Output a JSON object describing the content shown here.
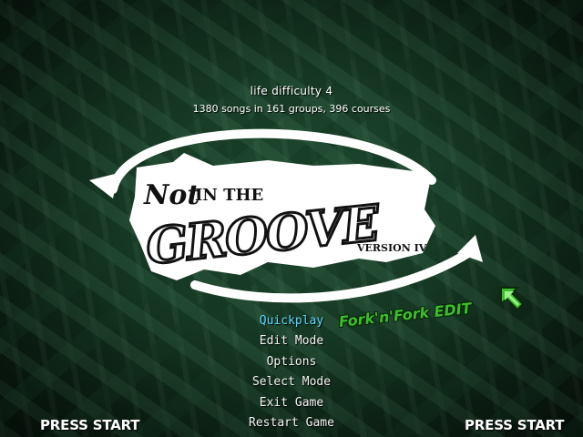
{
  "header": {
    "difficulty": "life difficulty 4",
    "song_stats": "1380 songs in 161 groups, 396 courses"
  },
  "logo": {
    "word_not": "Not",
    "word_in_the": "IN THE",
    "word_groove": "GROOVE",
    "version": "VERSION IV"
  },
  "menu": {
    "items": [
      {
        "label": "Quickplay",
        "selected": true
      },
      {
        "label": "Edit Mode",
        "selected": false
      },
      {
        "label": "Options",
        "selected": false
      },
      {
        "label": "Select Mode",
        "selected": false
      },
      {
        "label": "Exit Game",
        "selected": false
      },
      {
        "label": "Restart Game",
        "selected": false
      }
    ]
  },
  "badge": {
    "text": "Fork'n'Fork EDIT",
    "icon": "green-arrow-icon"
  },
  "players": {
    "p1_prompt": "PRESS START",
    "p2_prompt": "PRESS START"
  },
  "colors": {
    "selected_item": "#5fd8ff",
    "menu_text": "#f4f4f4",
    "badge_green": "#3cbe2c",
    "background": "#13321f"
  }
}
